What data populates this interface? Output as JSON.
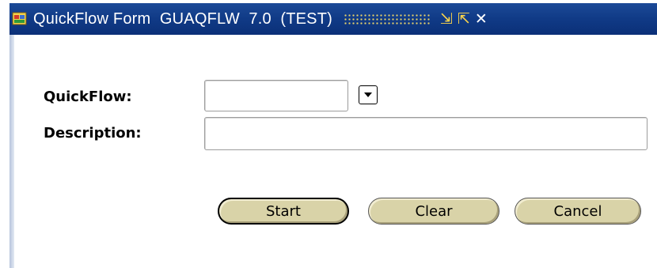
{
  "window": {
    "title": "QuickFlow Form  GUAQFLW  7.0  (TEST)",
    "controls": {
      "minimize": "⇲",
      "maximize": "⇱",
      "close": "✕"
    }
  },
  "form": {
    "quickflow_label": "QuickFlow:",
    "quickflow_value": "",
    "description_label": "Description:",
    "description_value": ""
  },
  "buttons": {
    "start": "Start",
    "clear": "Clear",
    "cancel": "Cancel"
  },
  "colors": {
    "titlebar": "#103a86",
    "button_face": "#d9d3a8"
  }
}
